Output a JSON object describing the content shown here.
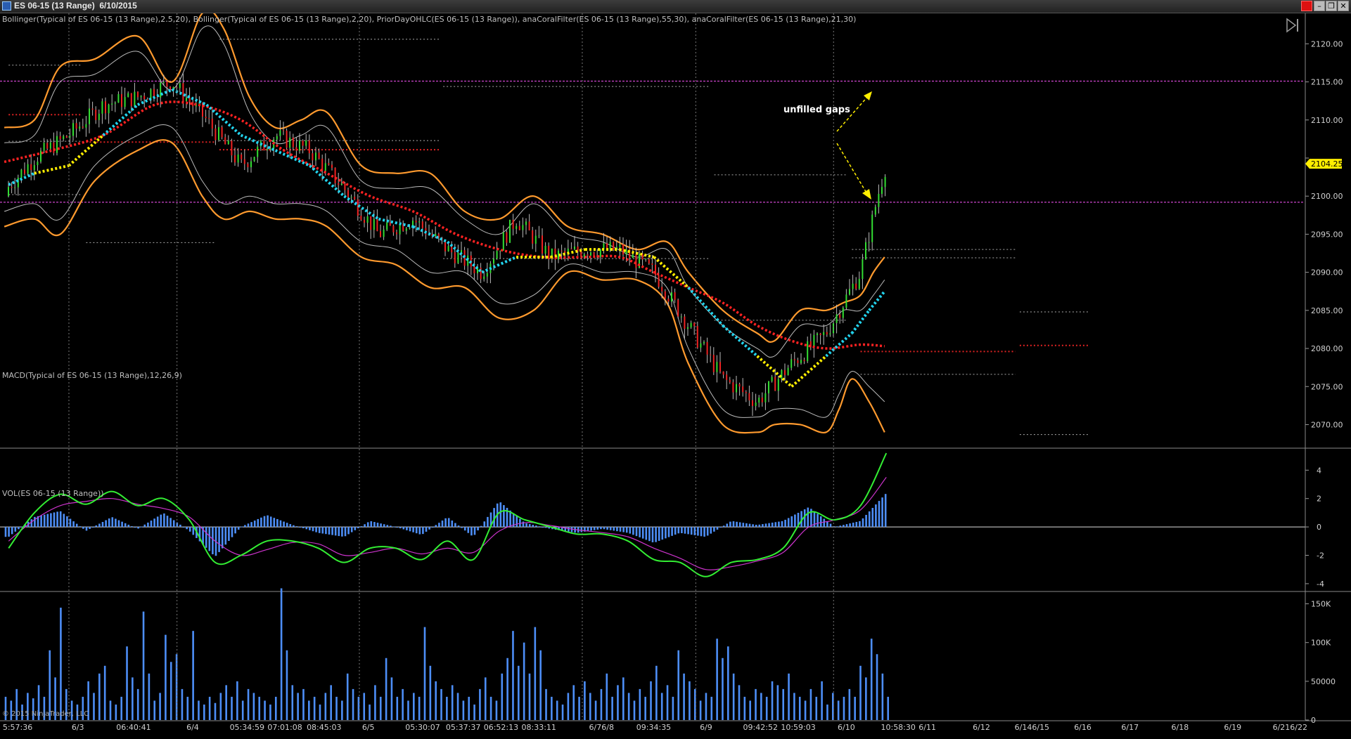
{
  "window": {
    "title": "ES 06-15 (13 Range)  6/10/2015",
    "min_label": "–",
    "restore_label": "❐",
    "close_label": "✕",
    "alert_color": "#dd1111"
  },
  "colors": {
    "bollinger_outer": "#ff9a2e",
    "bollinger_inner": "#bbbbbb",
    "slow_filter": "#ff2222",
    "fast_filter_up": "#22d4ee",
    "fast_filter_flat": "#ffee00",
    "macd_line": "#33ee33",
    "signal_line": "#cc33cc",
    "macd_hist": "#4d8ef7",
    "volume": "#4d8ef7",
    "up_bar": "#33dd33",
    "down_bar": "#ee2222",
    "level_line": "#cc44cc",
    "price_badge": "#ffee00"
  },
  "chart_data": [
    {
      "type": "line",
      "panel": "price",
      "indicators_label": "Bollinger(Typical of ES 06-15 (13 Range),2.5,20), Bollinger(Typical of ES 06-15 (13 Range),2,20), PriorDayOHLC(ES 06-15 (13 Range)), anaCoralFilter(ES 06-15 (13 Range),55,30), anaCoralFilter(ES 06-15 (13 Range),21,30)",
      "ylim": [
        2067,
        2124
      ],
      "yticks": [
        2070,
        2075,
        2080,
        2085,
        2090,
        2095,
        2100,
        2105,
        2110,
        2115,
        2120
      ],
      "ytick_labels": [
        "2070.00",
        "2075.00",
        "2080.00",
        "2085.00",
        "2090.00",
        "2095.00",
        "2100.00",
        "",
        "2110.00",
        "2115.00",
        "2120.00"
      ],
      "last_price": 2104.25,
      "last_price_label": "2104.25",
      "horizontal_levels": [
        2115.1,
        2099.2
      ],
      "annotation": "unfilled gaps",
      "series": [
        {
          "key": "close",
          "x": [
            0,
            40,
            80,
            120,
            160,
            200,
            240,
            280,
            320,
            360,
            400,
            440,
            480,
            520,
            560,
            600,
            640,
            680,
            720,
            760,
            800,
            840,
            880,
            920,
            960,
            1000,
            1020,
            1030
          ],
          "values": [
            2100,
            2105,
            2108,
            2112,
            2113,
            2115,
            2110,
            2104,
            2108,
            2106,
            2101,
            2095,
            2097,
            2093,
            2090,
            2097,
            2092,
            2093,
            2093,
            2090,
            2083,
            2076,
            2073,
            2078,
            2082,
            2090,
            2100,
            2104.25
          ]
        },
        {
          "key": "bb_upper_outer",
          "x": [
            5,
            40,
            70,
            110,
            160,
            200,
            235,
            260,
            290,
            320,
            350,
            380,
            420,
            460,
            500,
            540,
            580,
            620,
            660,
            700,
            740,
            775,
            800,
            840,
            880,
            900,
            930,
            960,
            980,
            1000,
            1015,
            1028
          ],
          "values": [
            2109,
            2110,
            2117,
            2118,
            2121,
            2115,
            2124,
            2122,
            2113,
            2109,
            2110,
            2111,
            2104,
            2103,
            2103,
            2098,
            2097,
            2100,
            2096,
            2095,
            2093,
            2094,
            2090,
            2085,
            2082,
            2081,
            2085,
            2085,
            2086,
            2087,
            2090,
            2092
          ]
        },
        {
          "key": "bb_lower_outer",
          "x": [
            5,
            40,
            70,
            110,
            160,
            200,
            235,
            260,
            290,
            320,
            350,
            380,
            420,
            460,
            500,
            540,
            580,
            620,
            660,
            700,
            740,
            775,
            800,
            840,
            880,
            900,
            930,
            960,
            975,
            990,
            1010,
            1028
          ],
          "values": [
            2096,
            2097,
            2095,
            2102,
            2106,
            2107,
            2100,
            2097,
            2098,
            2097,
            2097,
            2096,
            2092,
            2091,
            2088,
            2088,
            2084,
            2085,
            2090,
            2089,
            2089,
            2086,
            2078,
            2070,
            2069,
            2070,
            2070,
            2069,
            2072,
            2076,
            2073,
            2069
          ]
        },
        {
          "key": "bb_upper_inner",
          "x": [
            5,
            40,
            70,
            110,
            160,
            200,
            235,
            260,
            290,
            320,
            350,
            380,
            420,
            460,
            500,
            540,
            580,
            620,
            660,
            700,
            740,
            775,
            800,
            840,
            880,
            900,
            930,
            960,
            980,
            1000,
            1015,
            1028
          ],
          "values": [
            2107,
            2108,
            2115,
            2116,
            2119,
            2114,
            2122,
            2120,
            2111,
            2107,
            2108,
            2109,
            2102,
            2101,
            2101,
            2097,
            2095,
            2099,
            2095,
            2094,
            2092,
            2093,
            2088,
            2083,
            2080,
            2079,
            2083,
            2083,
            2085,
            2085,
            2087,
            2089
          ]
        },
        {
          "key": "bb_lower_inner",
          "x": [
            5,
            40,
            70,
            110,
            160,
            200,
            235,
            260,
            290,
            320,
            350,
            380,
            420,
            460,
            500,
            540,
            580,
            620,
            660,
            700,
            740,
            775,
            800,
            840,
            880,
            900,
            930,
            960,
            975,
            990,
            1010,
            1028
          ],
          "values": [
            2098,
            2099,
            2097,
            2104,
            2108,
            2109,
            2102,
            2099,
            2100,
            2099,
            2099,
            2098,
            2094,
            2093,
            2090,
            2090,
            2086,
            2087,
            2091,
            2090,
            2090,
            2088,
            2080,
            2072,
            2071,
            2072,
            2072,
            2071,
            2074,
            2077,
            2075,
            2073
          ]
        },
        {
          "key": "coral_slow",
          "x": [
            5,
            60,
            120,
            180,
            230,
            280,
            330,
            380,
            430,
            480,
            530,
            580,
            630,
            680,
            720,
            760,
            800,
            840,
            880,
            920,
            960,
            1000,
            1028
          ],
          "values": [
            2104.5,
            2106,
            2108,
            2112,
            2112,
            2110,
            2106,
            2103,
            2100,
            2098,
            2095,
            2093,
            2092,
            2092,
            2092,
            2090,
            2088,
            2086,
            2083,
            2081,
            2080,
            2080.5,
            2080.3
          ]
        },
        {
          "key": "coral_fast",
          "x": [
            10,
            40,
            80,
            120,
            160,
            200,
            240,
            280,
            320,
            360,
            400,
            440,
            480,
            520,
            560,
            600,
            640,
            680,
            720,
            760,
            800,
            840,
            880,
            920,
            960,
            990,
            1010,
            1028
          ],
          "values": [
            2101.5,
            2103,
            2104,
            2108,
            2112,
            2114,
            2112,
            2108,
            2106,
            2104,
            2100,
            2097,
            2096,
            2094,
            2090,
            2092,
            2092,
            2093,
            2093,
            2092,
            2088,
            2083,
            2079,
            2075,
            2079,
            2082,
            2085,
            2087.5
          ]
        }
      ]
    },
    {
      "type": "line",
      "panel": "macd",
      "indicators_label": "MACD(Typical of ES 06-15 (13 Range),12,26,9)",
      "ylim": [
        -4.5,
        5.5
      ],
      "yticks": [
        -4,
        -2,
        0,
        2,
        4
      ],
      "ytick_labels": [
        "-4",
        "-2",
        "0",
        "2",
        "4"
      ],
      "series": [
        {
          "key": "macd",
          "x": [
            10,
            40,
            70,
            100,
            130,
            160,
            190,
            220,
            250,
            280,
            310,
            340,
            370,
            400,
            430,
            460,
            490,
            520,
            550,
            580,
            610,
            640,
            670,
            700,
            730,
            760,
            790,
            820,
            850,
            880,
            910,
            940,
            970,
            1000,
            1030
          ],
          "values": [
            -1.5,
            1,
            2.3,
            1.6,
            2.5,
            1.5,
            2,
            0.5,
            -2.5,
            -2,
            -1,
            -1,
            -1.5,
            -2.5,
            -1.5,
            -1.5,
            -2.3,
            -1,
            -2.3,
            1,
            0.5,
            0,
            -0.5,
            -0.5,
            -1,
            -2.3,
            -2.5,
            -3.5,
            -2.5,
            -2.3,
            -1.5,
            1,
            0.5,
            1.5,
            5.2
          ]
        },
        {
          "key": "signal",
          "x": [
            10,
            40,
            70,
            100,
            130,
            160,
            190,
            220,
            250,
            280,
            310,
            340,
            370,
            400,
            430,
            460,
            490,
            520,
            550,
            580,
            610,
            640,
            670,
            700,
            730,
            760,
            790,
            820,
            850,
            880,
            910,
            940,
            970,
            1000,
            1030
          ],
          "values": [
            -1,
            0.5,
            1.5,
            1.8,
            2,
            1.6,
            1.3,
            0.7,
            -1,
            -2,
            -1.6,
            -1.1,
            -1.2,
            -2,
            -1.8,
            -1.5,
            -1.9,
            -1.5,
            -1.8,
            -0.3,
            0.3,
            0.1,
            -0.2,
            -0.4,
            -0.7,
            -1.5,
            -2.2,
            -3,
            -2.8,
            -2.4,
            -1.8,
            0,
            0.5,
            1.2,
            3.5
          ]
        }
      ]
    },
    {
      "type": "bar",
      "panel": "volume",
      "indicators_label": "VOL(ES 06-15 (13 Range))",
      "ylim": [
        0,
        165000
      ],
      "yticks": [
        0,
        50000,
        100000,
        150000
      ],
      "ytick_labels": [
        "0",
        "50000",
        "100K",
        "150K"
      ],
      "values": [
        30000,
        25000,
        40000,
        20000,
        35000,
        28000,
        45000,
        30000,
        90000,
        55000,
        145000,
        40000,
        25000,
        20000,
        30000,
        50000,
        35000,
        60000,
        70000,
        25000,
        20000,
        30000,
        95000,
        55000,
        40000,
        140000,
        60000,
        25000,
        35000,
        110000,
        75000,
        85000,
        40000,
        30000,
        115000,
        25000,
        20000,
        30000,
        22000,
        35000,
        45000,
        30000,
        50000,
        25000,
        40000,
        35000,
        30000,
        25000,
        20000,
        30000,
        170000,
        90000,
        45000,
        35000,
        40000,
        25000,
        30000,
        20000,
        35000,
        45000,
        30000,
        25000,
        60000,
        40000,
        30000,
        35000,
        20000,
        45000,
        30000,
        80000,
        55000,
        30000,
        40000,
        25000,
        35000,
        30000,
        120000,
        70000,
        50000,
        40000,
        30000,
        45000,
        35000,
        25000,
        30000,
        20000,
        40000,
        55000,
        30000,
        25000,
        60000,
        80000,
        115000,
        70000,
        100000,
        60000,
        120000,
        90000,
        40000,
        30000,
        25000,
        20000,
        35000,
        45000,
        30000,
        50000,
        35000,
        25000,
        40000,
        60000,
        30000,
        45000,
        55000,
        35000,
        25000,
        40000,
        30000,
        50000,
        70000,
        35000,
        45000,
        30000,
        90000,
        60000,
        50000,
        40000,
        25000,
        35000,
        30000,
        105000,
        80000,
        95000,
        60000,
        45000,
        30000,
        25000,
        40000,
        35000,
        30000,
        50000,
        45000,
        40000,
        60000,
        35000,
        30000,
        25000,
        40000,
        30000,
        50000,
        20000,
        35000,
        25000,
        30000,
        40000,
        30000,
        70000,
        55000,
        105000,
        85000,
        60000,
        30000
      ]
    }
  ],
  "time_axis": {
    "labels": [
      "5:57:36",
      "6/3",
      "06:40:41",
      "6/4",
      "05:34:59",
      "07:01:08",
      "08:45:03",
      "6/5",
      "05:30:07",
      "05:37:37",
      "06:52:13",
      "08:33:11",
      "6/76/8",
      "09:34:35",
      "6/9",
      "09:42:52",
      "10:59:03",
      "6/10",
      "10:58:30",
      "6/11",
      "6/12",
      "6/146/15",
      "6/16",
      "6/17",
      "6/18",
      "6/19",
      "6/216/22"
    ],
    "positions": [
      0.002,
      0.053,
      0.086,
      0.138,
      0.17,
      0.198,
      0.227,
      0.268,
      0.3,
      0.33,
      0.358,
      0.386,
      0.436,
      0.471,
      0.518,
      0.55,
      0.578,
      0.62,
      0.652,
      0.68,
      0.72,
      0.751,
      0.795,
      0.83,
      0.867,
      0.906,
      0.942
    ],
    "day_separators": [
      0.051,
      0.131,
      0.266,
      0.431,
      0.515,
      0.617
    ]
  },
  "copyright": "© 2015 NinjaTrader, LLC"
}
